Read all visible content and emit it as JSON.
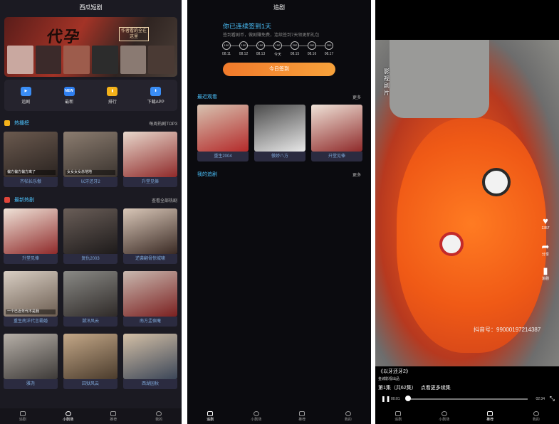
{
  "panel1": {
    "title": "西瓜短剧",
    "banner": {
      "headline": "代孕",
      "caption": "作者看的全在这里"
    },
    "nav": [
      {
        "label": "追剧",
        "icon": "play-icon",
        "color": "#3a8df5",
        "badge": ""
      },
      {
        "label": "最新",
        "icon": "new-icon",
        "color": "#2f7ff0",
        "badge": "NEW"
      },
      {
        "label": "排行",
        "icon": "rank-icon",
        "color": "#f4b21a",
        "badge": ""
      },
      {
        "label": "下载APP",
        "icon": "download-icon",
        "color": "#3a8df5",
        "badge": ""
      }
    ],
    "hot": {
      "title": "热播榜",
      "more": "每周热剧TOP3",
      "items": [
        {
          "caption": "齐帖长乐傲",
          "overlay": "偏方偏方偏方离了"
        },
        {
          "caption": "以牙还牙2",
          "overlay": "女女女女赤地地"
        },
        {
          "caption": "升堂见俸",
          "overlay": ""
        }
      ]
    },
    "latest": {
      "title": "最新热剧",
      "more": "查看全部热剧",
      "items": [
        {
          "caption": "升堂见俸",
          "overlay": ""
        },
        {
          "caption": "复仇2003",
          "overlay": ""
        },
        {
          "caption": "逆袭翻骨惊城啸",
          "overlay": ""
        },
        {
          "caption": "重生南洋代言霸婚",
          "overlay": "一个已近年代不是我"
        },
        {
          "caption": "潮汛风云",
          "overlay": ""
        },
        {
          "caption": "南方孟宿庵",
          "overlay": ""
        },
        {
          "caption": "雅尧",
          "overlay": ""
        },
        {
          "caption": "囚狱风云",
          "overlay": ""
        },
        {
          "caption": "西湖园秋",
          "overlay": ""
        }
      ]
    },
    "tabs": [
      "追剧",
      "小剧场",
      "推荐",
      "我的"
    ],
    "active_tab": 1
  },
  "panel2": {
    "title": "追剧",
    "sign_title": "你已连续签到1天",
    "sign_sub": "签到看剧币，做剧赚免费，连续签到7天领更新礼包",
    "days": [
      {
        "amount": "100",
        "date": "08.11"
      },
      {
        "amount": "100",
        "date": "08.12"
      },
      {
        "amount": "100",
        "date": "08.13"
      },
      {
        "amount": "100",
        "date": "今天"
      },
      {
        "amount": "200",
        "date": "08.15"
      },
      {
        "amount": "200",
        "date": "08.16"
      },
      {
        "amount": "200",
        "date": "08.17"
      }
    ],
    "sign_button": "今日签到",
    "recent": {
      "title": "最近观看",
      "more": "更多",
      "items": [
        {
          "caption": "重生2004"
        },
        {
          "caption": "傲娇八方"
        },
        {
          "caption": "升堂见俸"
        }
      ]
    },
    "my": {
      "title": "我的追剧",
      "more": "更多"
    },
    "tabs": [
      "追剧",
      "小剧场",
      "推荐",
      "我的"
    ],
    "active_tab": 0
  },
  "panel3": {
    "vertical_text": "影视剧片",
    "actions": [
      {
        "label": "1357",
        "icon": "heart-icon"
      },
      {
        "label": "分享",
        "icon": "share-icon"
      },
      {
        "label": "追剧",
        "icon": "bookmark-icon"
      }
    ],
    "watermark": "抖音号：99000197214387",
    "episode_title": "《以牙还牙2》",
    "author": "金城影视出品",
    "episode": "第1集",
    "total": "（共62集）",
    "more_text": "点看更多续集",
    "time_current": "00:01",
    "time_total": "02:34",
    "tabs": [
      "追剧",
      "小剧场",
      "推荐",
      "我的"
    ],
    "active_tab": 2
  },
  "colors": {
    "accent": "#4cc4ff",
    "sign": "#f4862f",
    "bg": "#1b1a22"
  }
}
